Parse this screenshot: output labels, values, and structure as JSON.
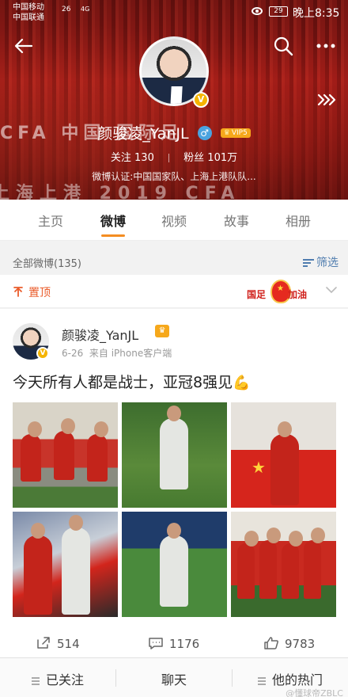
{
  "status_bar": {
    "carrier_1": "中国移动",
    "carrier_2": "中国联通",
    "signal_1": "26",
    "signal_2": "4G",
    "battery": "29",
    "time": "晚上8:35"
  },
  "banner": {
    "line_1": "CFA 中国 国际足",
    "line_2": "上海上港 2019 CFA"
  },
  "profile": {
    "name": "颜骏凌_YanJL",
    "gender_symbol": "♂",
    "vip_label": "VIP5",
    "verified_badge": "V",
    "following_label": "关注",
    "following_count": "130",
    "followers_label": "粉丝",
    "followers_count": "101万",
    "verification": "微博认证:中国国家队、上海上港队队..."
  },
  "tabs": [
    {
      "label": "主页",
      "active": false
    },
    {
      "label": "微博",
      "active": true
    },
    {
      "label": "视频",
      "active": false
    },
    {
      "label": "故事",
      "active": false
    },
    {
      "label": "相册",
      "active": false
    }
  ],
  "filter": {
    "label": "全部微博(135)",
    "button": "筛选"
  },
  "pinned": {
    "label": "置顶",
    "sticker_left": "国足",
    "sticker_right": "加油"
  },
  "post": {
    "author": "颜骏凌_YanJL",
    "date": "6-26",
    "source": "来自 iPhone客户端",
    "text": "今天所有人都是战士，亚冠8强见",
    "emoji": "💪",
    "photos": [
      "team-celebration-photo",
      "goalkeeper-photo",
      "flag-photo",
      "hug-photo",
      "goalkeeper-action-photo",
      "team-lineup-photo"
    ]
  },
  "actions": {
    "shares": "514",
    "comments": "1176",
    "likes": "9783"
  },
  "bottom_bar": {
    "following": "已关注",
    "chat": "聊天",
    "hot": "他的热门",
    "watermark": "@懂球帝ZBLC"
  },
  "colors": {
    "accent_orange": "#f48d22",
    "link_blue": "#507daf",
    "pin_orange": "#ea5c2b",
    "verified_gold": "#f5b400"
  }
}
